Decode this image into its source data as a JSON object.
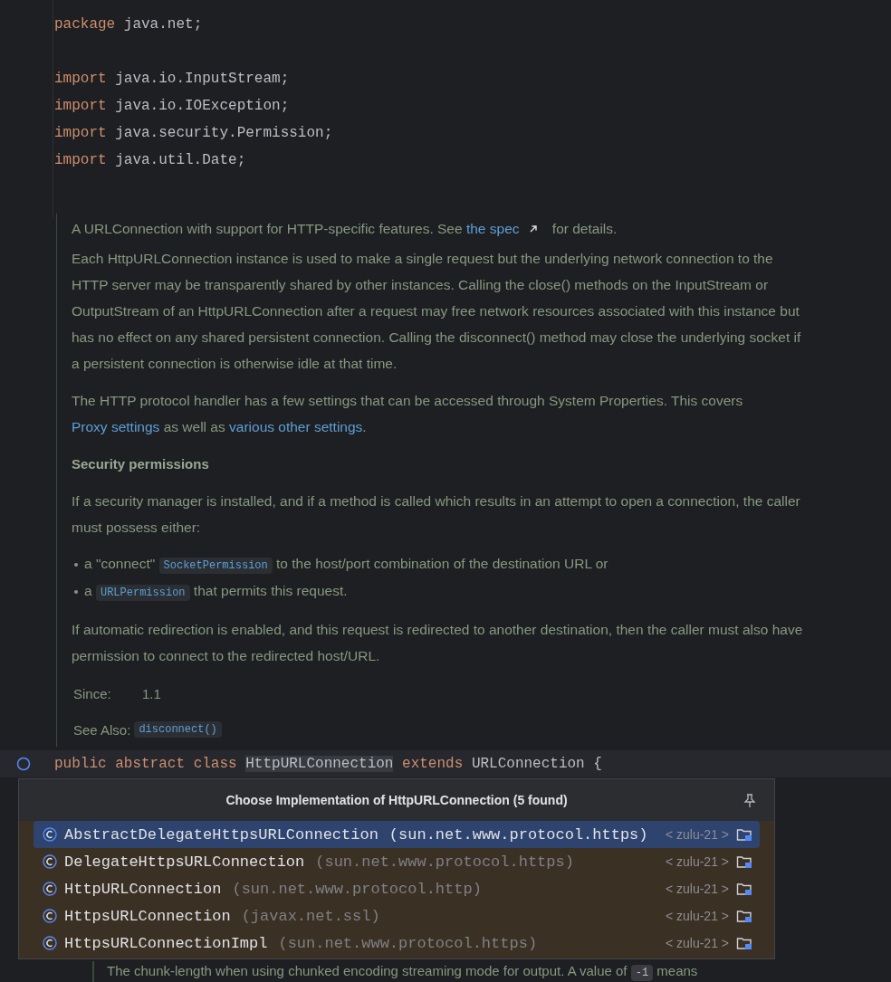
{
  "code_groups": [
    [
      {
        "segments": [
          {
            "kind": "keyword",
            "text": "package"
          },
          {
            "kind": "plain",
            "text": "java.net;"
          }
        ]
      }
    ],
    [
      {
        "segments": [
          {
            "kind": "keyword",
            "text": "import"
          },
          {
            "kind": "plain",
            "text": "java.io.InputStream;"
          }
        ]
      },
      {
        "segments": [
          {
            "kind": "keyword",
            "text": "import"
          },
          {
            "kind": "plain",
            "text": "java.io.IOException;"
          }
        ]
      },
      {
        "segments": [
          {
            "kind": "keyword",
            "text": "import"
          },
          {
            "kind": "plain",
            "text": "java.security.Permission;"
          }
        ]
      },
      {
        "segments": [
          {
            "kind": "keyword",
            "text": "import"
          },
          {
            "kind": "plain",
            "text": "java.util.Date;"
          }
        ]
      }
    ]
  ],
  "doc": {
    "blocks": [
      {
        "kind": "paragraph",
        "segments": [
          {
            "kind": "text",
            "text": "A URLConnection with support for HTTP-specific features. See "
          },
          {
            "kind": "external_link",
            "text": "the spec"
          },
          {
            "kind": "text",
            "text": " for details."
          }
        ]
      },
      {
        "kind": "paragraph",
        "segments": [
          {
            "kind": "text",
            "text": "Each HttpURLConnection instance is used to make a single request but the underlying network connection to the HTTP server may be transparently shared by other instances. Calling the close() methods on the InputStream or OutputStream of an HttpURLConnection after a request may free network resources associated with this instance but has no effect on any shared persistent connection. Calling the disconnect()  method may close the underlying socket if a persistent connection is otherwise idle at that time."
          }
        ]
      },
      {
        "kind": "paragraph",
        "segments": [
          {
            "kind": "text",
            "text": "The HTTP protocol handler has a few settings that can be accessed through System Properties. This covers "
          },
          {
            "kind": "link",
            "text": "Proxy settings"
          },
          {
            "kind": "text",
            "text": " as well as "
          },
          {
            "kind": "link",
            "text": "various other settings"
          },
          {
            "kind": "text",
            "text": "."
          }
        ]
      },
      {
        "kind": "heading",
        "segments": [
          {
            "kind": "text",
            "text": "Security permissions"
          }
        ]
      },
      {
        "kind": "paragraph",
        "segments": [
          {
            "kind": "text",
            "text": "If a security manager is installed, and if a method is called which results in an attempt to open a connection, the caller must possess either:"
          }
        ]
      },
      {
        "kind": "bullets",
        "items": [
          {
            "segments": [
              {
                "kind": "text",
                "text": "a \"connect\" "
              },
              {
                "kind": "code",
                "text": "SocketPermission"
              },
              {
                "kind": "text",
                "text": " to the host/port combination of the destination URL or"
              }
            ]
          },
          {
            "segments": [
              {
                "kind": "text",
                "text": "a "
              },
              {
                "kind": "code",
                "text": "URLPermission"
              },
              {
                "kind": "text",
                "text": " that permits this request."
              }
            ]
          }
        ]
      },
      {
        "kind": "paragraph",
        "segments": [
          {
            "kind": "text",
            "text": "If automatic redirection is enabled, and this request is redirected to another destination, then the caller must also have permission to connect to the redirected host/URL."
          }
        ]
      }
    ],
    "since": {
      "label": "Since:",
      "value": "1.1"
    },
    "see_also": {
      "label": "See Also:",
      "items": [
        "disconnect()"
      ]
    }
  },
  "class_line": {
    "segments": [
      {
        "kind": "keyword",
        "text": "public abstract class"
      },
      {
        "kind": "highlight",
        "text": "HttpURLConnection"
      },
      {
        "kind": "keyword",
        "text": "extends"
      },
      {
        "kind": "plain",
        "text": "URLConnection {"
      }
    ]
  },
  "popup": {
    "title": "Choose Implementation of HttpURLConnection (5 found)",
    "items": [
      {
        "name": "AbstractDelegateHttpsURLConnection",
        "package": "(sun.net.www.protocol.https)",
        "library": "< zulu-21 >",
        "selected": true
      },
      {
        "name": "DelegateHttpsURLConnection",
        "package": "(sun.net.www.protocol.https)",
        "library": "< zulu-21 >",
        "selected": false
      },
      {
        "name": "HttpURLConnection",
        "package": "(sun.net.www.protocol.http)",
        "library": "< zulu-21 >",
        "selected": false
      },
      {
        "name": "HttpsURLConnection",
        "package": "(javax.net.ssl)",
        "library": "< zulu-21 >",
        "selected": false
      },
      {
        "name": "HttpsURLConnectionImpl",
        "package": "(sun.net.www.protocol.https)",
        "library": "< zulu-21 >",
        "selected": false
      }
    ]
  },
  "bottom_doc": {
    "segments": [
      {
        "kind": "text",
        "text": "The chunk-length when using chunked encoding streaming mode for output. A value of "
      },
      {
        "kind": "code",
        "text": "-1"
      },
      {
        "kind": "text",
        "text": " means"
      }
    ]
  }
}
